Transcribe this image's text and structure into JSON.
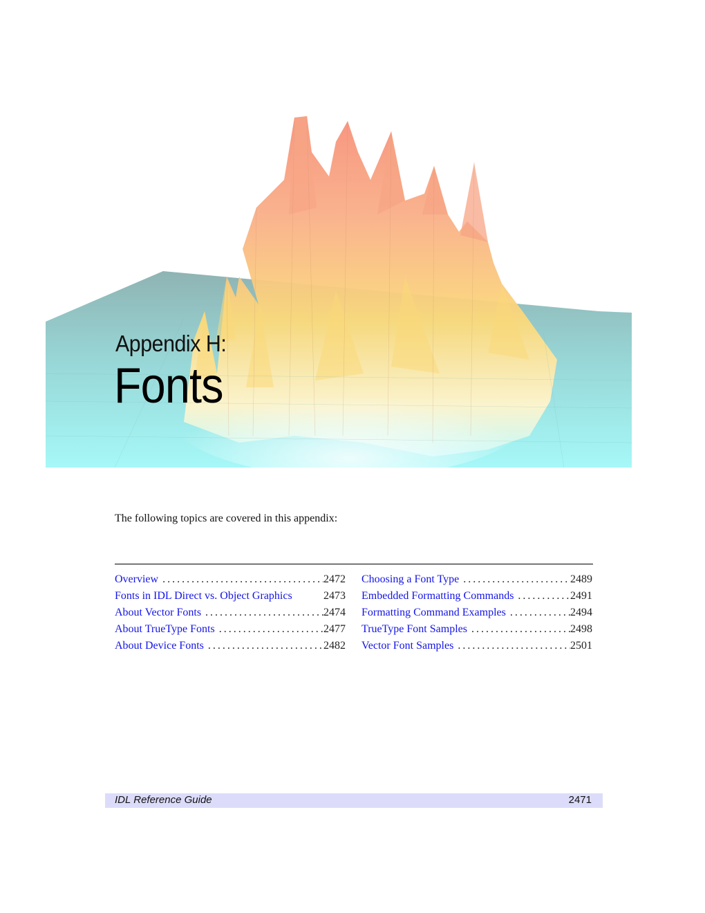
{
  "chapter": {
    "label": "Appendix H:",
    "title": "Fonts"
  },
  "hero_image": {
    "description": "3D surface plot with orange/yellow peaks rising from cyan plane",
    "colors": {
      "peak": "#f7907a",
      "mid": "#fbd97a",
      "base": "#a6f6f6",
      "plane_far": "#8fb3b3"
    }
  },
  "intro": "The following topics are covered in this appendix:",
  "toc": {
    "left": [
      {
        "title": "Overview",
        "page": "2472"
      },
      {
        "title": "Fonts in IDL Direct vs. Object Graphics",
        "page": "2473"
      },
      {
        "title": "About Vector Fonts",
        "page": "2474"
      },
      {
        "title": "About TrueType Fonts",
        "page": "2477"
      },
      {
        "title": "About Device Fonts",
        "page": "2482"
      }
    ],
    "right": [
      {
        "title": "Choosing a Font Type",
        "page": "2489"
      },
      {
        "title": "Embedded Formatting Commands",
        "page": "2491"
      },
      {
        "title": "Formatting Command Examples",
        "page": "2494"
      },
      {
        "title": "TrueType Font Samples",
        "page": "2498"
      },
      {
        "title": "Vector Font Samples",
        "page": "2501"
      }
    ]
  },
  "footer": {
    "book_title": "IDL Reference Guide",
    "page_number": "2471"
  },
  "colors": {
    "link": "#1414e6",
    "footer_bg": "#dcdcfa"
  }
}
